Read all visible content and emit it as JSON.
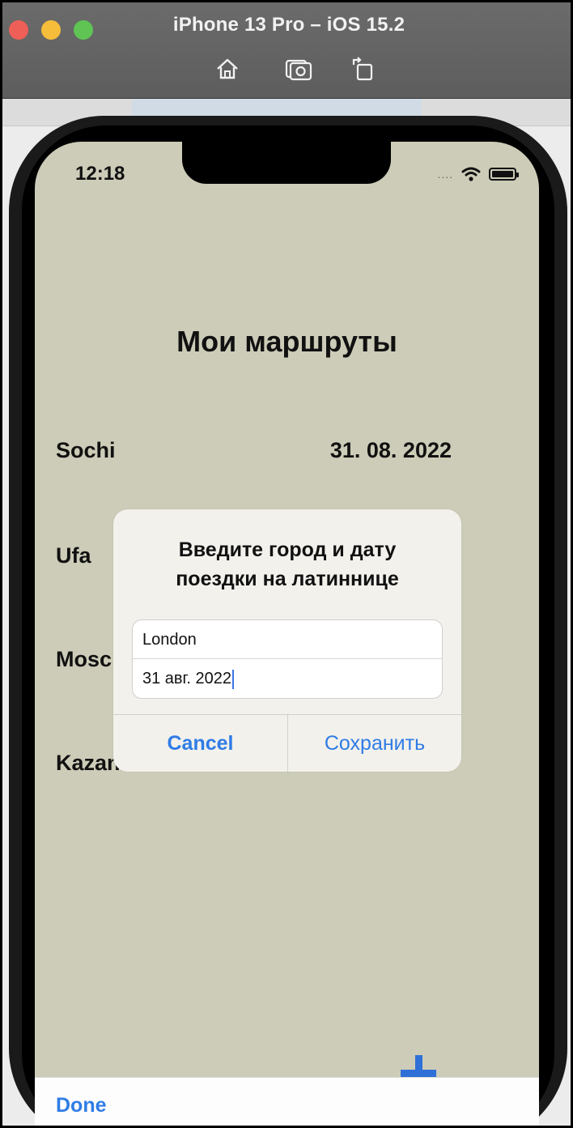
{
  "window": {
    "title": "iPhone 13 Pro – iOS 15.2",
    "toolbar_icons": [
      "home-icon",
      "screenshot-icon",
      "rotate-icon"
    ]
  },
  "status_bar": {
    "time": "12:18",
    "signal": "....",
    "icons": [
      "wifi-icon",
      "battery-icon"
    ]
  },
  "app": {
    "title": "Мои маршруты",
    "routes": [
      {
        "city": "Sochi",
        "date": "31. 08. 2022"
      },
      {
        "city": "Ufa",
        "date": ""
      },
      {
        "city": "Mosc",
        "date": ""
      },
      {
        "city": "Kazan",
        "date": ""
      }
    ],
    "add_icon": "plus-icon",
    "toolbar": {
      "done_label": "Done"
    }
  },
  "alert": {
    "title": "Введите город и дату\nпоездки на латиннице",
    "city_value": "London",
    "date_value": "31 авг. 2022",
    "cancel_label": "Cancel",
    "save_label": "Сохранить"
  },
  "colors": {
    "app_background": "#cdccb8",
    "accent": "#2f7ce6",
    "alert_background": "#f2f1ec"
  }
}
